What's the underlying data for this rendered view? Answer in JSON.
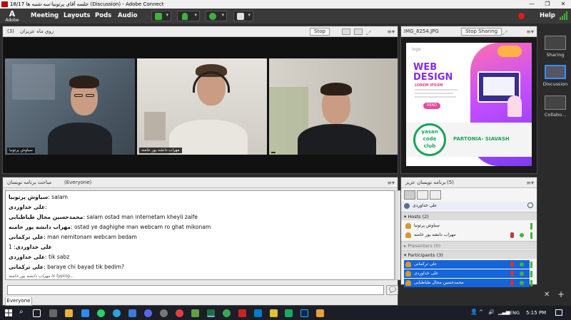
{
  "window": {
    "title": "18/17 جلسه آقای پرتونیا-سه شنبه ها (Discussion) - Adobe Connect",
    "controls": [
      "—",
      "❐",
      "✕"
    ]
  },
  "app": {
    "logo_text": "Adobe"
  },
  "menubar": {
    "items": [
      "Meeting",
      "Layouts",
      "Pods",
      "Audio"
    ],
    "help": "Help"
  },
  "video_pod": {
    "title": "روي ماه عزيزان",
    "count": "(3)",
    "stop_label": "Stop",
    "tiles": [
      {
        "name": "سیاوش پرتونیا"
      },
      {
        "name": "مهراب دانشه پور خامنه"
      },
      {
        "name": ""
      }
    ]
  },
  "share_pod": {
    "title": "IMG_8254.JPG",
    "stop_sharing": "Stop Sharing",
    "poster": {
      "logo": "logo",
      "heading_1": "WEB",
      "heading_2": "DESIGN",
      "subheading": "LOREM IPSUM",
      "read_button": "READ",
      "club_1": "yasan",
      "club_2": "code",
      "club_3": "club",
      "footer": "PARTONIA- SIAVASH"
    }
  },
  "chat_pod": {
    "title": "مباحث برنامه نويسان",
    "scope": "(Everyone)",
    "messages": [
      {
        "sender": "سیاوش پرتونیا",
        "text": "salam"
      },
      {
        "sender": "علی خداوردی",
        "text": ""
      },
      {
        "sender": "محمدحسین مجال طباطبایی",
        "text": "salam ostad man internetam kheyli zaife"
      },
      {
        "sender": "مهراب دانشه پور خامنه",
        "text": "ostad ye daghighe man webcam ro ghat mikonam"
      },
      {
        "sender": "علی ترکمانی",
        "text": "man nemitonam webcam bedam"
      },
      {
        "sender": "علی خداوردی",
        "text": "1"
      },
      {
        "sender": "علی خداوردی",
        "text": "tik sabz"
      },
      {
        "sender": "علی ترکمانی",
        "text": "baraye chi bayad tik bedim?"
      }
    ],
    "typing": "مهراب دانشه پور خامنه is typing...",
    "tab": "Everyone"
  },
  "attendees_pod": {
    "title": "برنامه نويسان عزيز",
    "count": "(5)",
    "me": "علی خداوردی",
    "hosts_label": "Hosts (2)",
    "hosts": [
      "سیاوش پرتونیا",
      "مهراب دانشه پور خامنه"
    ],
    "presenters_label": "Presenters (0)",
    "participants_label": "Participants (3)",
    "participants": [
      "علی ترکمانی",
      "علی خداوردی",
      "محمدحسین مجال طباطبایی"
    ]
  },
  "rail": {
    "items": [
      "Sharing",
      "Discussion",
      "Collabo..."
    ]
  },
  "taskbar": {
    "lang": "ENG",
    "time": "5:15 PM"
  },
  "colors": {
    "accent_blue": "#1565d8",
    "record_red": "#e21a1a",
    "poster_green": "#1aa35a",
    "poster_purple": "#8a2be2"
  }
}
